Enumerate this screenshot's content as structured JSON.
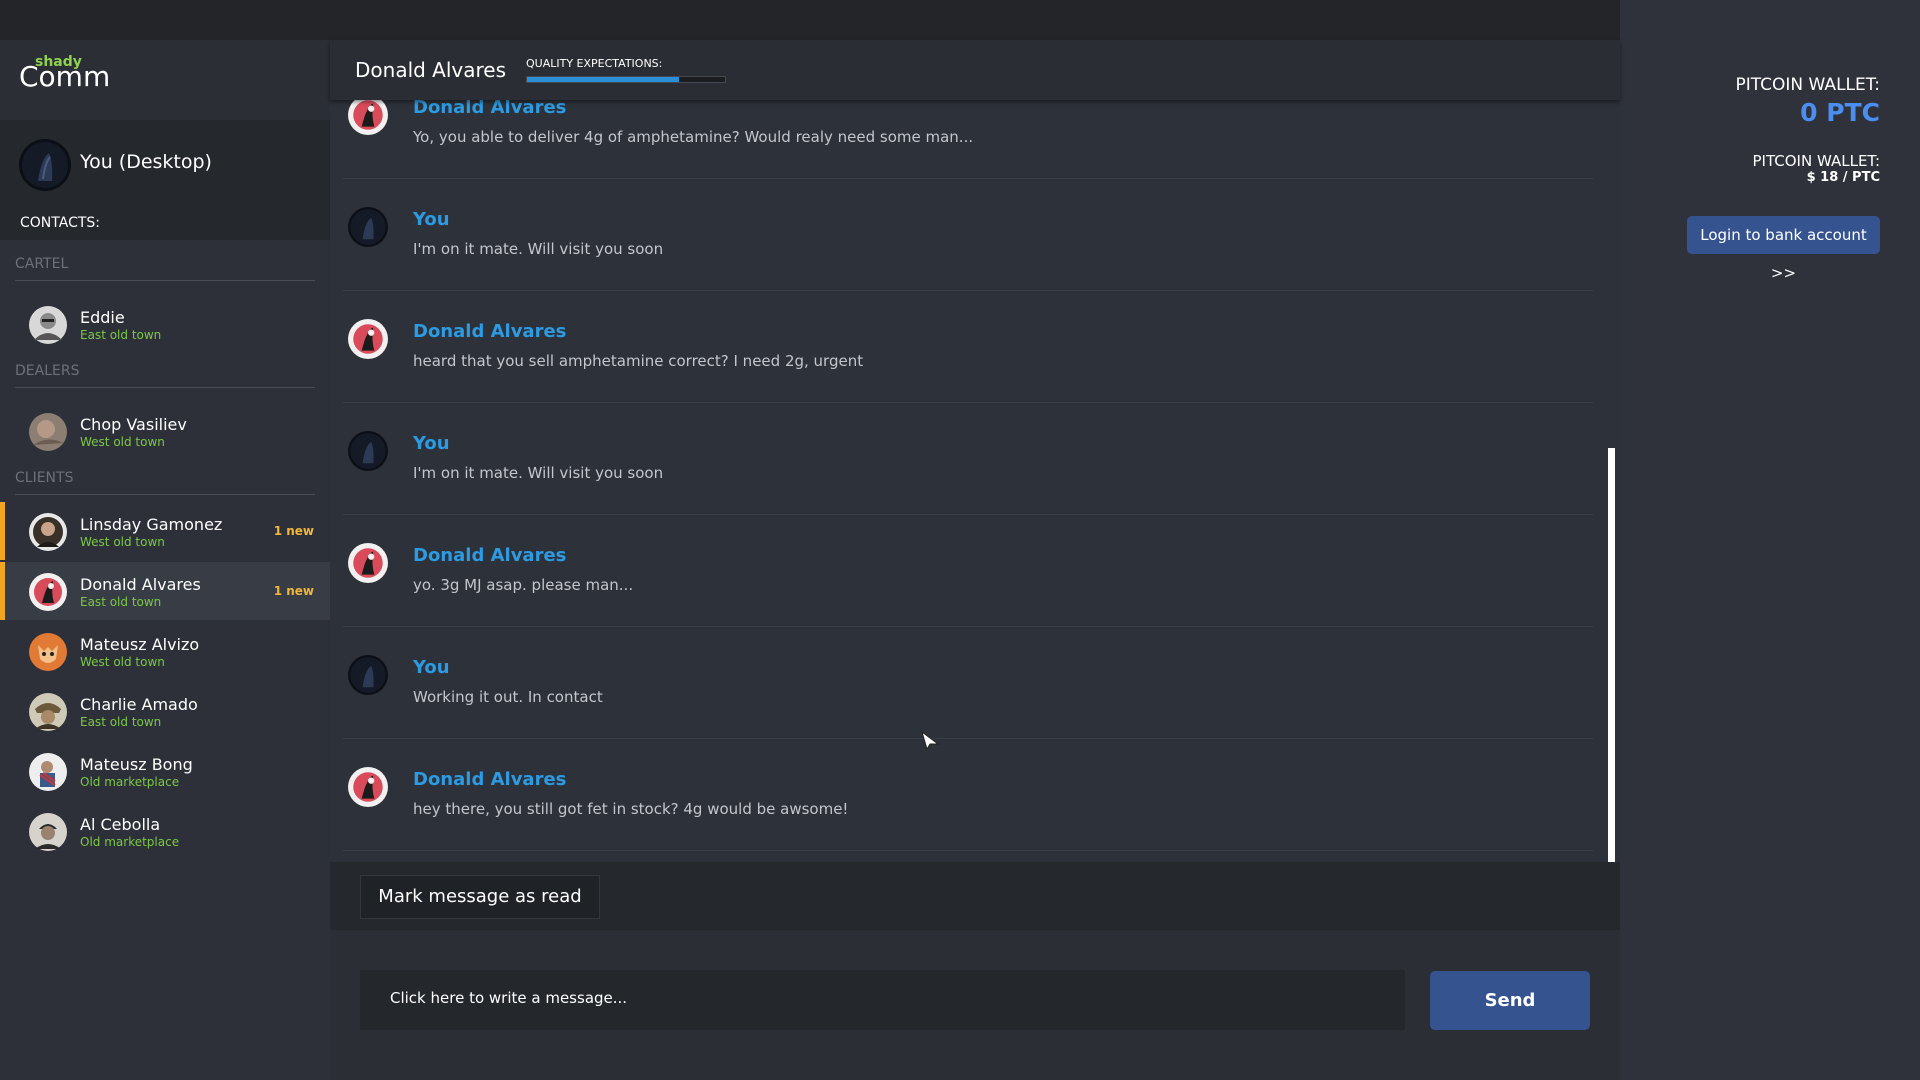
{
  "app": {
    "logo_top": "shady",
    "logo_bottom": "Comm"
  },
  "me": {
    "name": "You (Desktop)",
    "contacts_label": "CONTACTS:"
  },
  "groups": {
    "cartel": "CARTEL",
    "dealers": "DEALERS",
    "clients": "CLIENTS"
  },
  "contacts": [
    {
      "name": "Eddie",
      "location": "East old town",
      "badge": ""
    },
    {
      "name": "Chop Vasiliev",
      "location": "West old town",
      "badge": ""
    },
    {
      "name": "Linsday Gamonez",
      "location": "West old town",
      "badge": "1 new"
    },
    {
      "name": "Donald Alvares",
      "location": "East old town",
      "badge": "1 new"
    },
    {
      "name": "Mateusz Alvizo",
      "location": "West old town",
      "badge": ""
    },
    {
      "name": "Charlie Amado",
      "location": "East old town",
      "badge": ""
    },
    {
      "name": "Mateusz Bong",
      "location": "Old marketplace",
      "badge": ""
    },
    {
      "name": "Al Cebolla",
      "location": "Old marketplace",
      "badge": ""
    }
  ],
  "chat": {
    "title": "Donald Alvares",
    "quality_label": "QUALITY EXPECTATIONS:",
    "quality_level": 0.77,
    "messages": [
      {
        "sender": "Donald Alvares",
        "text": "Yo, you able to deliver 4g of amphetamine? Would realy need some man..."
      },
      {
        "sender": "You",
        "text": "I'm on it mate. Will visit you soon"
      },
      {
        "sender": "Donald Alvares",
        "text": "heard that you sell amphetamine correct? I need 2g, urgent"
      },
      {
        "sender": "You",
        "text": "I'm on it mate. Will visit you soon"
      },
      {
        "sender": "Donald Alvares",
        "text": "yo. 3g MJ asap. please man..."
      },
      {
        "sender": "You",
        "text": "Working it out. In contact"
      },
      {
        "sender": "Donald Alvares",
        "text": "hey there, you still got fet in stock? 4g would be awsome!"
      }
    ],
    "mark_read_label": "Mark message as read",
    "input_placeholder": "Click here to write a message...",
    "send_label": "Send"
  },
  "wallet": {
    "label": "PITCOIN WALLET:",
    "value": "0 PTC",
    "rate_label": "PITCOIN WALLET:",
    "rate_value": "$ 18 / PTC",
    "bank_button": "Login to bank account >>"
  },
  "colors": {
    "accent_blue": "#2d9ae2",
    "location_green": "#7ac943",
    "badge_orange": "#f0b63a",
    "button_blue": "#35548f"
  }
}
